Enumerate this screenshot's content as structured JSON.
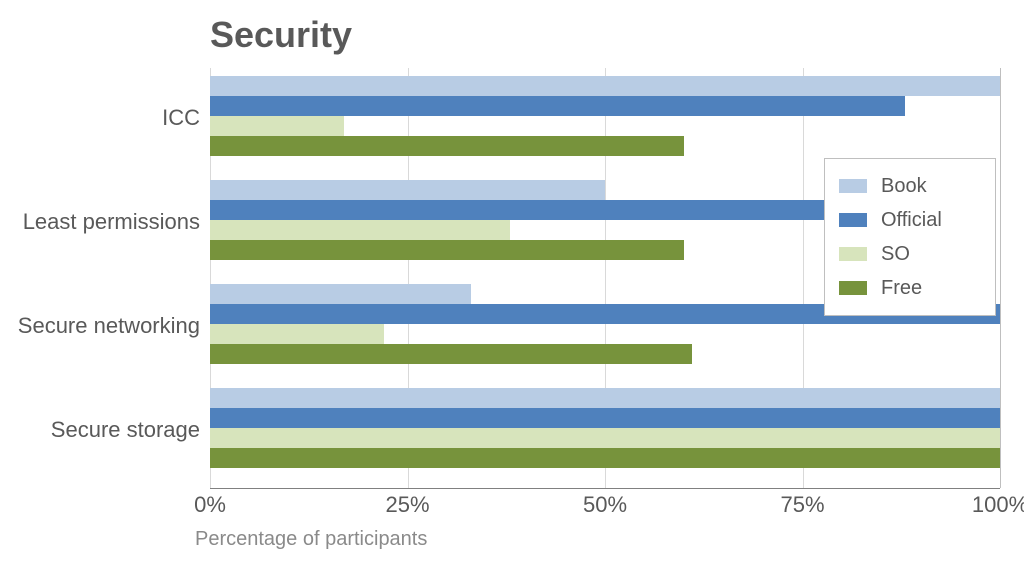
{
  "chart_data": {
    "type": "bar",
    "orientation": "horizontal",
    "title": "Security",
    "xlabel": "Percentage of participants",
    "ylabel": "",
    "xlim": [
      0,
      100
    ],
    "x_ticks": [
      0,
      25,
      50,
      75,
      100
    ],
    "x_tick_labels": [
      "0%",
      "25%",
      "50%",
      "75%",
      "100%"
    ],
    "categories": [
      "ICC",
      "Least permissions",
      "Secure networking",
      "Secure storage"
    ],
    "series": [
      {
        "name": "Book",
        "values": [
          100,
          50,
          33,
          100
        ]
      },
      {
        "name": "Official",
        "values": [
          88,
          80,
          100,
          100
        ]
      },
      {
        "name": "SO",
        "values": [
          17,
          38,
          22,
          100
        ]
      },
      {
        "name": "Free",
        "values": [
          60,
          60,
          61,
          100
        ]
      }
    ],
    "legend_position": "right"
  },
  "colors": {
    "book": "#b8cce4",
    "official": "#4f81bd",
    "so": "#d7e4bc",
    "free": "#77933c"
  }
}
